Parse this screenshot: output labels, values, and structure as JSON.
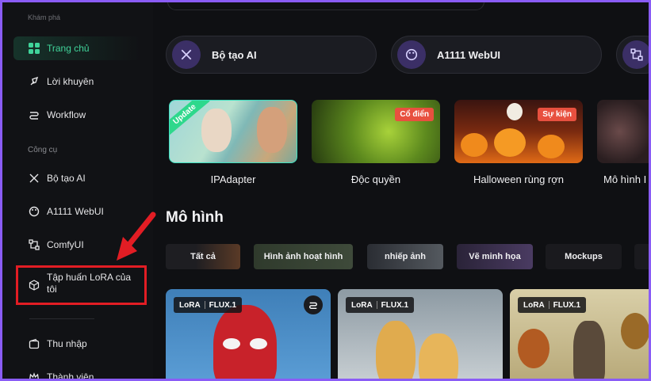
{
  "sidebar": {
    "top_text": "Khám phá",
    "items_top": [
      {
        "label": "Trang chủ",
        "icon": "grid-icon",
        "active": true
      },
      {
        "label": "Lời khuyên",
        "icon": "rocket-icon"
      },
      {
        "label": "Workflow",
        "icon": "workflow-icon"
      }
    ],
    "section_tools": "Công cụ",
    "items_tools": [
      {
        "label": "Bộ tạo AI",
        "icon": "sparkle-icon"
      },
      {
        "label": "A1111 WebUI",
        "icon": "palette-icon"
      },
      {
        "label": "ComfyUI",
        "icon": "nodes-icon"
      },
      {
        "label": "Tập huấn LoRA của tôi",
        "icon": "cube-icon"
      }
    ],
    "items_bottom": [
      {
        "label": "Thu nhập",
        "icon": "wallet-icon"
      },
      {
        "label": "Thành viên",
        "icon": "crown-icon"
      }
    ]
  },
  "tools": [
    {
      "label": "Bộ tạo AI",
      "icon": "sparkle-icon"
    },
    {
      "label": "A1111 WebUI",
      "icon": "palette-icon"
    },
    {
      "label": "",
      "icon": "nodes-icon"
    }
  ],
  "features": [
    {
      "title": "IPAdapter",
      "badge": "Update"
    },
    {
      "title": "Độc quyền",
      "badge": "Cổ điển"
    },
    {
      "title": "Halloween rùng rợn",
      "badge": "Sự kiện"
    },
    {
      "title": "Mô hình I",
      "badge": ""
    }
  ],
  "models_section": {
    "title": "Mô hình",
    "chips": [
      "Tất cả",
      "Hình ảnh hoạt hình",
      "nhiếp ảnh",
      "Vẽ minh họa",
      "Mockups"
    ],
    "cards": [
      {
        "type": "LoRA",
        "base": "FLUX.1"
      },
      {
        "type": "LoRA",
        "base": "FLUX.1"
      },
      {
        "type": "LoRA",
        "base": "FLUX.1"
      }
    ]
  },
  "colors": {
    "accent_green": "#40d49a",
    "highlight_red": "#e21d24",
    "frame_purple": "#8a5cf6"
  }
}
